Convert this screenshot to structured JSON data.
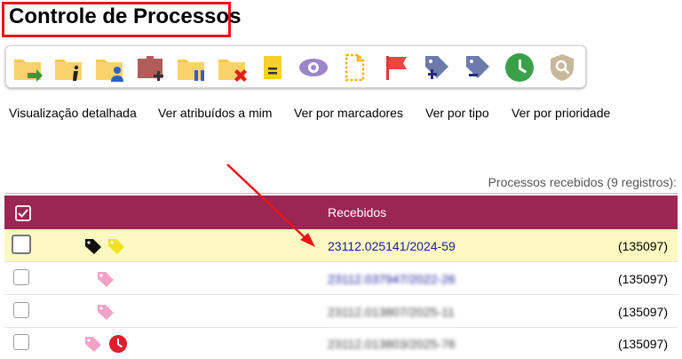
{
  "title": "Controle de Processos",
  "toolbar": [
    {
      "name": "new-process-icon"
    },
    {
      "name": "process-info-icon"
    },
    {
      "name": "assigned-user-icon"
    },
    {
      "name": "new-block-icon"
    },
    {
      "name": "pause-process-icon"
    },
    {
      "name": "remove-process-icon"
    },
    {
      "name": "note-icon"
    },
    {
      "name": "view-icon"
    },
    {
      "name": "document-outline-icon"
    },
    {
      "name": "flag-icon"
    },
    {
      "name": "add-tag-icon"
    },
    {
      "name": "remove-tag-icon"
    },
    {
      "name": "clock-icon"
    },
    {
      "name": "search-shield-icon"
    }
  ],
  "views": [
    "Visualização detalhada",
    "Ver atribuídos a mim",
    "Ver por marcadores",
    "Ver por tipo",
    "Ver por prioridade"
  ],
  "caption": "Processos recebidos (9 registros):",
  "table": {
    "header": "Recebidos",
    "rows": [
      {
        "process": "23112.025141/2024-59",
        "code": "(135097)"
      },
      {
        "process": "23112.037947/2022-26",
        "code": "(135097)"
      },
      {
        "process": "23112.013807/2025-11",
        "code": "(135097)"
      },
      {
        "process": "23112.013803/2025-76",
        "code": "(135097)"
      }
    ]
  },
  "colors": {
    "header": "#9b2553",
    "selected_row": "#fbf9c1",
    "highlight": "#e8151b",
    "link": "#1a1a9a"
  }
}
